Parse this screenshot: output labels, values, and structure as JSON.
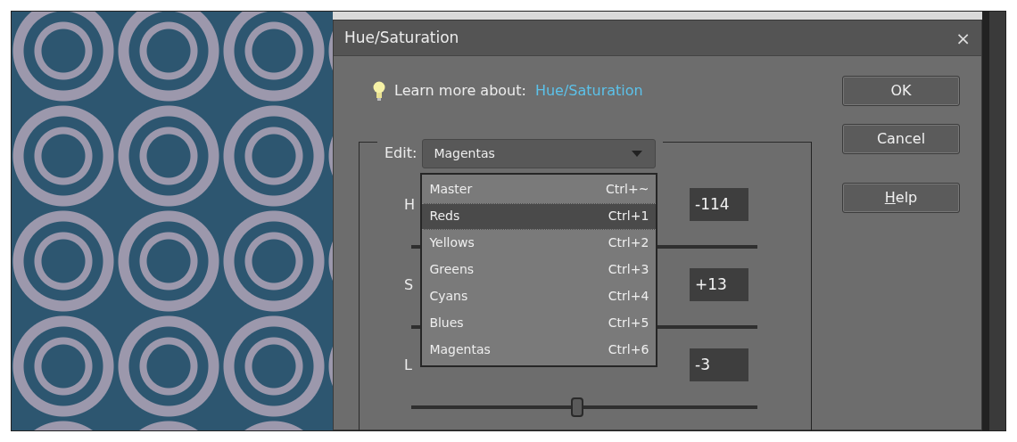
{
  "dialog": {
    "title": "Hue/Saturation",
    "close": "×"
  },
  "learn_more": {
    "label": "Learn more about:",
    "link": "Hue/Saturation"
  },
  "edit": {
    "label": "Edit:",
    "value": "Magentas",
    "menu": [
      {
        "label": "Master",
        "shortcut": "Ctrl+~",
        "highlighted": false
      },
      {
        "label": "Reds",
        "shortcut": "Ctrl+1",
        "highlighted": true
      },
      {
        "label": "Yellows",
        "shortcut": "Ctrl+2",
        "highlighted": false
      },
      {
        "label": "Greens",
        "shortcut": "Ctrl+3",
        "highlighted": false
      },
      {
        "label": "Cyans",
        "shortcut": "Ctrl+4",
        "highlighted": false
      },
      {
        "label": "Blues",
        "shortcut": "Ctrl+5",
        "highlighted": false
      },
      {
        "label": "Magentas",
        "shortcut": "Ctrl+6",
        "highlighted": false
      }
    ]
  },
  "sliders": [
    {
      "label": "H",
      "value": "-114"
    },
    {
      "label": "S",
      "value": "+13"
    },
    {
      "label": "L",
      "value": "-3",
      "level": 0.48
    }
  ],
  "buttons": [
    {
      "label": "OK"
    },
    {
      "label": "Cancel"
    },
    {
      "label": "Help",
      "mnemonic": true
    }
  ]
}
